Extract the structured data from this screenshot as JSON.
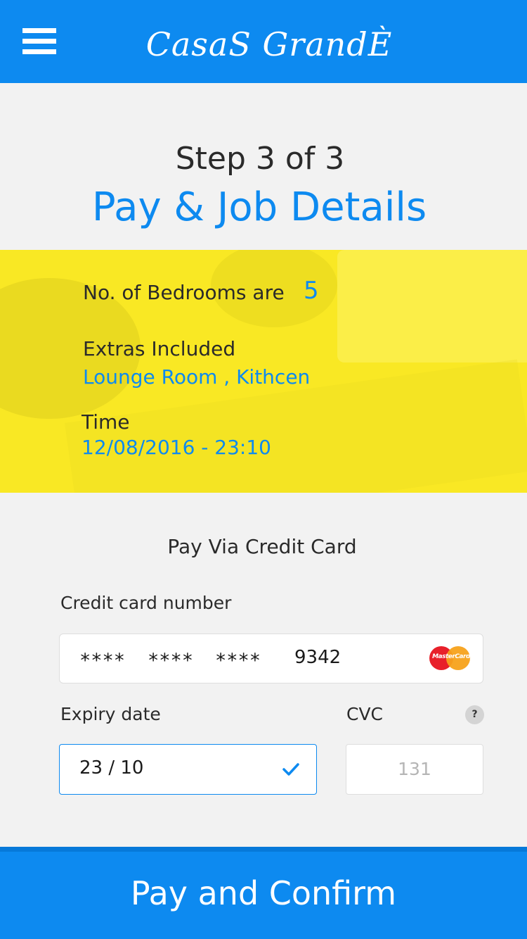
{
  "header": {
    "menu_icon": "hamburger-menu-icon",
    "brand": "CasaS GrandÈ",
    "color": "#0d8af0"
  },
  "progress": {
    "step_text": "Step 3 of 3",
    "title": "Pay & Job Details"
  },
  "details": {
    "bedrooms_label": "No. of Bedrooms  are",
    "bedrooms_value": "5",
    "extras_label": "Extras Included",
    "extras_value": "Lounge Room , Kithcen",
    "time_label": "Time",
    "time_value": "12/08/2016 - 23:10",
    "background_color": "#f9e824"
  },
  "payment": {
    "heading": "Pay Via Credit Card",
    "card_number_label": "Credit card number",
    "card_number_segments": [
      "****",
      "****",
      "****",
      "9342"
    ],
    "card_brand_icon": "mastercard-logo",
    "card_brand_text": "MasterCard",
    "expiry_label": "Expiry date",
    "expiry_value": "23 / 10",
    "expiry_valid_icon": "checkmark-icon",
    "cvc_label": "CVC",
    "cvc_help": "?",
    "cvc_placeholder": "131"
  },
  "actions": {
    "confirm_label": "Pay and Confirm"
  }
}
